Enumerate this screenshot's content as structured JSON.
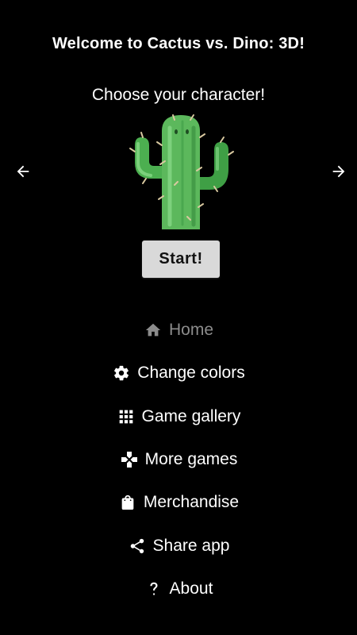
{
  "header": {
    "title": "Welcome to Cactus vs. Dino: 3D!",
    "subtitle": "Choose your character!"
  },
  "carousel": {
    "prev_icon": "arrow-left-icon",
    "next_icon": "arrow-right-icon",
    "character": "cactus"
  },
  "start_button": {
    "label": "Start!"
  },
  "menu": {
    "items": [
      {
        "label": "Home",
        "icon": "home-icon",
        "active": true
      },
      {
        "label": "Change colors",
        "icon": "gear-icon",
        "active": false
      },
      {
        "label": "Game gallery",
        "icon": "grid-icon",
        "active": false
      },
      {
        "label": "More games",
        "icon": "gamepad-icon",
        "active": false
      },
      {
        "label": "Merchandise",
        "icon": "shopping-bag-icon",
        "active": false
      },
      {
        "label": "Share app",
        "icon": "share-icon",
        "active": false
      },
      {
        "label": "About",
        "icon": "question-icon",
        "active": false
      }
    ]
  },
  "colors": {
    "background": "#000000",
    "text": "#ffffff",
    "active_menu": "#8c8c8c",
    "button_bg": "#d9d9d9",
    "cactus": "#5cb85c"
  }
}
